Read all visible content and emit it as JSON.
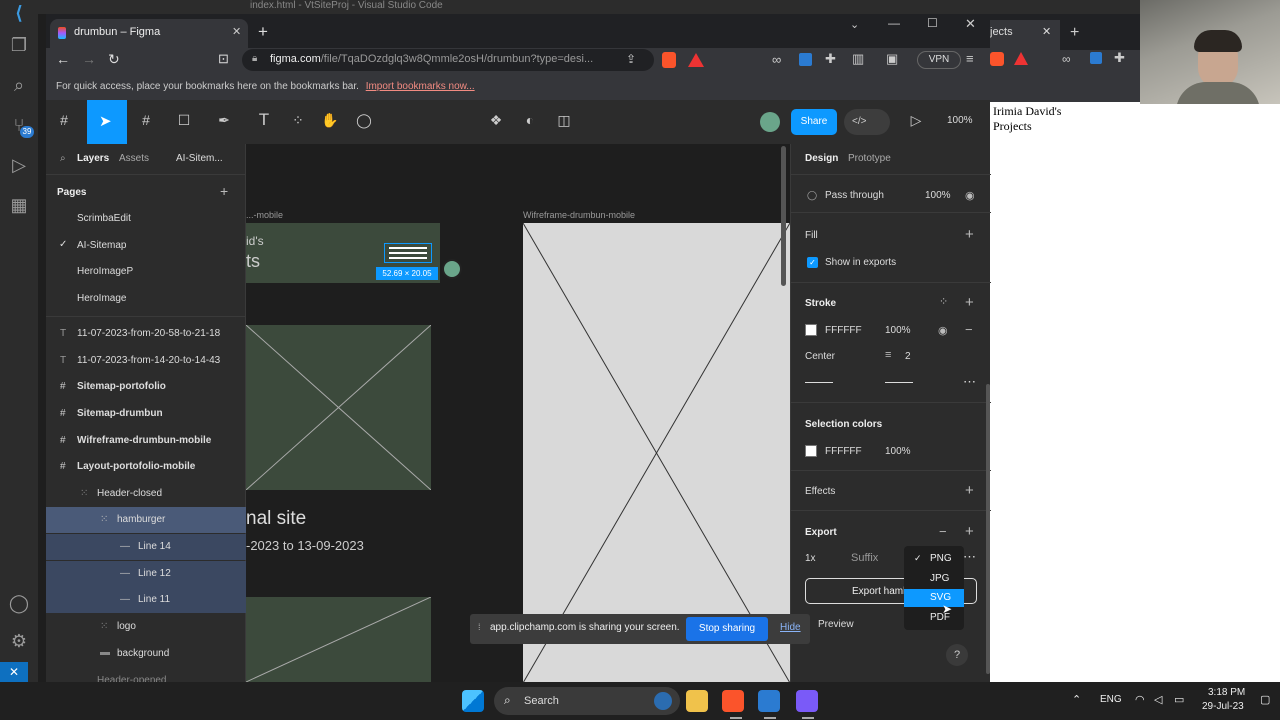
{
  "vscode": {
    "window_title": "index.html - VtSiteProj - Visual Studio Code",
    "badge_count": "39"
  },
  "browser": {
    "tab_title": "drumbun – Figma",
    "url_host": "figma.com",
    "url_path": "/file/TqaDOzdglq3w8Qmmle2osH/drumbun?type=desi...",
    "vpn_label": "VPN",
    "bookmarks_prompt": "For quick access, place your bookmarks here on the bookmarks bar.",
    "bookmarks_link": "Import bookmarks now..."
  },
  "figma": {
    "share_label": "Share",
    "zoom": "100%",
    "left_tabs": {
      "layers": "Layers",
      "assets": "Assets",
      "page": "AI-Sitem..."
    },
    "pages_title": "Pages",
    "pages": [
      "ScrimbaEdit",
      "AI-Sitemap",
      "HeroImageP",
      "HeroImage"
    ],
    "layers": [
      {
        "label": "11-07-2023-from-20-58-to-21-18"
      },
      {
        "label": "11-07-2023-from-14-20-to-14-43"
      },
      {
        "label": "Sitemap-portofolio"
      },
      {
        "label": "Sitemap-drumbun"
      },
      {
        "label": "Wifreframe-drumbun-mobile"
      },
      {
        "label": "Layout-portofolio-mobile"
      },
      {
        "label": "Header-closed"
      },
      {
        "label": "hamburger"
      },
      {
        "label": "Line 14"
      },
      {
        "label": "Line 12"
      },
      {
        "label": "Line 11"
      },
      {
        "label": "logo"
      },
      {
        "label": "background"
      },
      {
        "label": "Header-opened"
      }
    ],
    "canvas": {
      "left_frame_label": "...-mobile",
      "right_frame_label": "Wifreframe-drumbun-mobile",
      "text_ids": "id's",
      "text_ts": "ts",
      "size_badge": "52.69 × 20.05",
      "text_site": "nal site",
      "text_dates": "-2023 to 13-09-2023"
    },
    "right_tabs": {
      "design": "Design",
      "prototype": "Prototype"
    },
    "layer_blend": "Pass through",
    "layer_opacity": "100%",
    "fill": {
      "title": "Fill",
      "show_exports": "Show in exports"
    },
    "stroke": {
      "title": "Stroke",
      "hex": "FFFFFF",
      "opacity": "100%",
      "align": "Center",
      "weight": "2"
    },
    "selection_colors": {
      "title": "Selection colors",
      "hex": "FFFFFF",
      "opacity": "100%"
    },
    "effects_title": "Effects",
    "export": {
      "title": "Export",
      "scale": "1x",
      "suffix": "Suffix",
      "button": "Export hamb",
      "preview": "Preview"
    },
    "dropdown": [
      "PNG",
      "JPG",
      "SVG",
      "PDF"
    ],
    "help": "?"
  },
  "share_bar": {
    "message": "app.clipchamp.com is sharing your screen.",
    "stop": "Stop sharing",
    "hide": "Hide"
  },
  "right_window": {
    "tab_title": "jects",
    "text_line1": "Irimia David's",
    "text_line2": "Projects"
  },
  "taskbar": {
    "search": "Search",
    "lang": "ENG",
    "time": "3:18 PM",
    "date": "29-Jul-23"
  },
  "colors": {
    "accent": "#0d99ff",
    "selection": "#4a5a78",
    "frame_green": "#3c4a3c",
    "frame_gray": "#d9d9d9"
  }
}
